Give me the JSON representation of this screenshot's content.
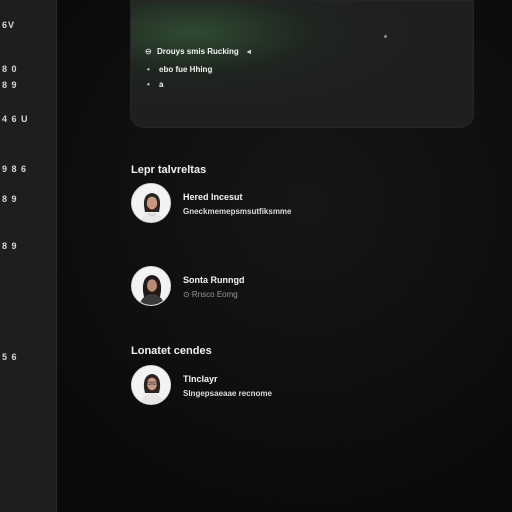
{
  "sidebar": {
    "items": [
      {
        "label": "6V"
      },
      {
        "label": "8 0"
      },
      {
        "label": "8 9"
      },
      {
        "label": "4 6 U"
      },
      {
        "label": "9 8 6"
      },
      {
        "label": "8 9"
      },
      {
        "label": "8 9"
      },
      {
        "label": "5 6"
      }
    ]
  },
  "hero": {
    "rows": [
      {
        "bullet": "⊖",
        "label": "Drouys smis Rucking",
        "caret": "◂"
      },
      {
        "bullet": "•",
        "label": "ebo    fue Hhing"
      },
      {
        "bullet": "•",
        "label": "a"
      }
    ]
  },
  "sections": {
    "first_title": "Lepr talvreltas",
    "second_title": "Lonatet cendes"
  },
  "people": [
    {
      "name": "Hered Incesut",
      "subtitle": "Gneckmemepsmsutfiksmme",
      "muted": false
    },
    {
      "name": "Sonta Runngd",
      "subtitle": "⊙ Rnsco Eomg",
      "muted": true
    },
    {
      "name": "Tlnclayr",
      "subtitle": "Slngepsaeaae recnome",
      "muted": false
    }
  ],
  "colors": {
    "background": "#0c0c0c",
    "sidebar": "#1e1e1e",
    "card": "#1f1f1f",
    "accent_green": "#3c6e41"
  },
  "icons": {
    "avatar": "person-portrait-icon",
    "bullet": "bullet-icon",
    "caret": "caret-left-icon"
  }
}
